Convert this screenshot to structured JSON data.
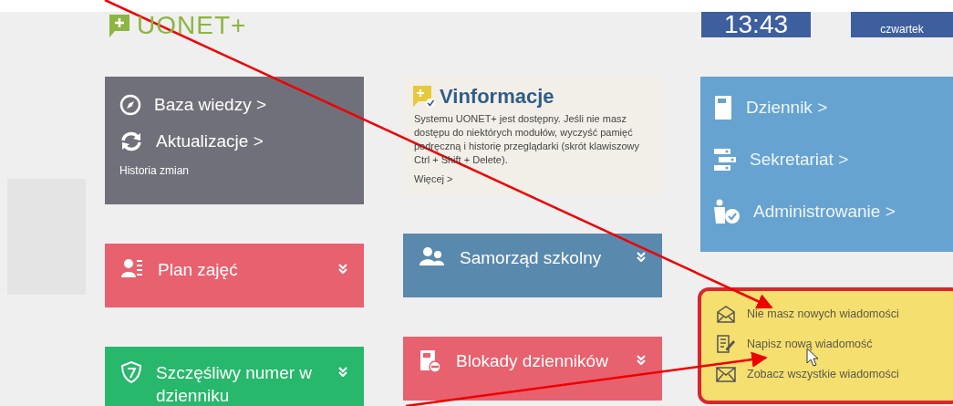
{
  "header": {
    "logo": "UONET+",
    "clock": "13:43",
    "weekday": "czwartek"
  },
  "info_panel": {
    "links": [
      "Baza wiedzy >",
      "Aktualizacje >"
    ],
    "note": "Historia zmian"
  },
  "vinformacje": {
    "title": "Vinformacje",
    "body": "Systemu UONET+ jest dostępny. Jeśli nie masz dostępu do niektórych modułów, wyczyść pamięć podręczną i historię przeglądarki (skrót klawiszowy Ctrl + Shift + Delete).",
    "more": "Więcej >"
  },
  "modules": {
    "links": [
      "Dziennik >",
      "Sekretariat >",
      "Administrowanie >"
    ]
  },
  "tiles_left": [
    {
      "title": "Plan zajęć",
      "color": "#e8616e"
    },
    {
      "title": "Szczęśliwy numer w dzienniku",
      "color": "#27b86b"
    }
  ],
  "tiles_middle": [
    {
      "title": "Samorząd szkolny",
      "color": "#5a89ae"
    },
    {
      "title": "Blokady dzienników",
      "color": "#e8616e"
    }
  ],
  "messages": [
    "Nie masz nowych wiadomości",
    "Napisz nową wiadomość",
    "Zobacz wszystkie wiadomości"
  ]
}
